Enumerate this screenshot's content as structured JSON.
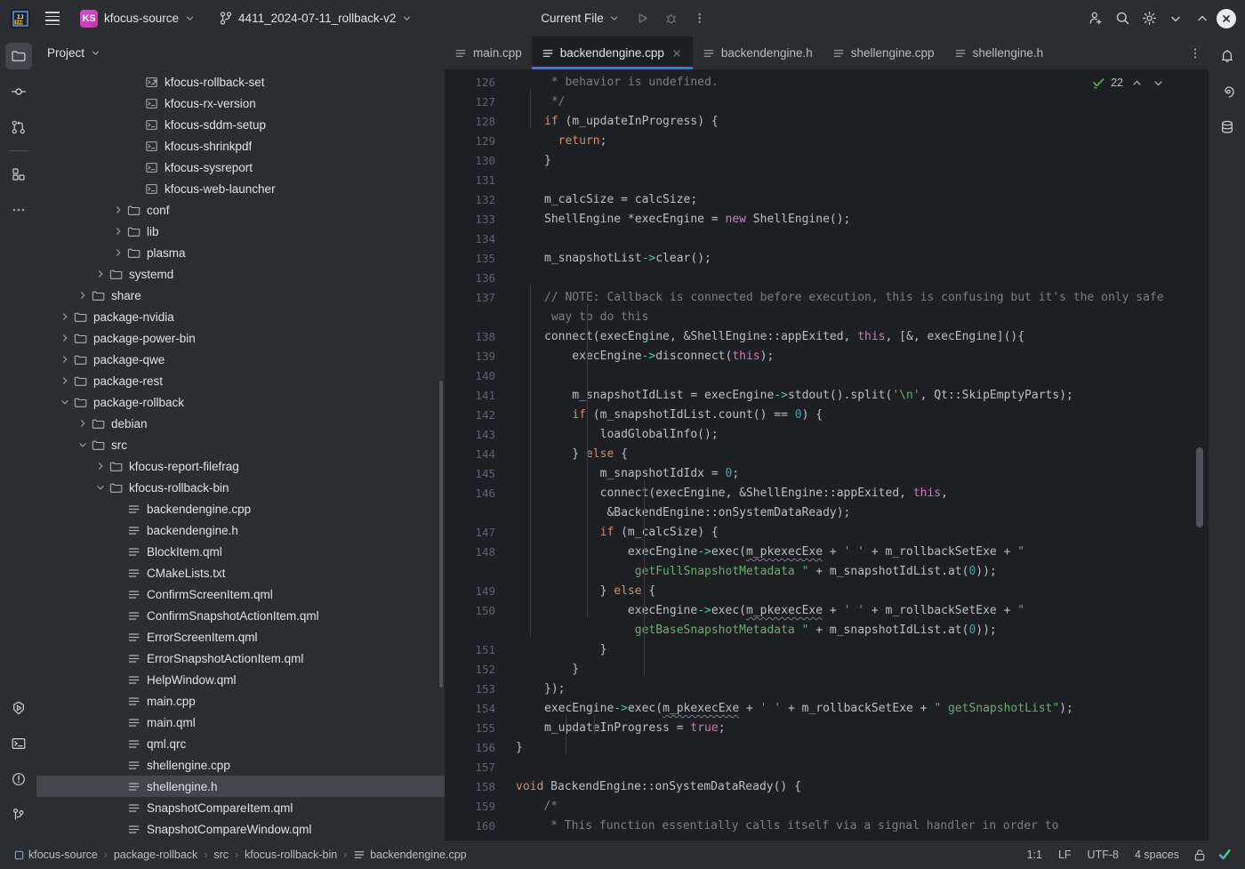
{
  "titlebar": {
    "menu_icon": "hamburger-icon",
    "logo": "intellij-idea-logo",
    "project_badge": "KS",
    "project_name": "kfocus-source",
    "branch_icon": "git-branch-icon",
    "branch_name": "4411_2024-07-11_rollback-v2",
    "run_config": "Current File",
    "run_icon": "run-icon",
    "debug_icon": "debug-icon",
    "more_icon": "more-vertical-icon",
    "share_icon": "add-user-icon",
    "search_icon": "search-icon",
    "settings_icon": "gear-icon",
    "minimize_icon": "chevron-down-icon",
    "maximize_icon": "chevron-up-icon",
    "close_icon": "close-icon"
  },
  "left_rail": {
    "items": [
      {
        "name": "project-tool-button",
        "icon": "folder-icon",
        "active": true
      },
      {
        "name": "commit-tool-button",
        "icon": "commit-icon",
        "active": false
      },
      {
        "name": "pull-requests-tool-button",
        "icon": "pull-request-icon",
        "active": false
      },
      {
        "name": "structure-tool-button",
        "icon": "structure-icon",
        "active": false
      },
      {
        "name": "more-tool-windows-button",
        "icon": "more-horizontal-icon",
        "active": false
      }
    ],
    "bottom_items": [
      {
        "name": "run-tool-button",
        "icon": "run-hexagon-icon"
      },
      {
        "name": "terminal-tool-button",
        "icon": "terminal-icon"
      },
      {
        "name": "problems-tool-button",
        "icon": "warning-circle-icon"
      },
      {
        "name": "git-tool-button",
        "icon": "git-branch-icon"
      }
    ]
  },
  "right_rail": {
    "items": [
      {
        "name": "notifications-button",
        "icon": "bell-icon"
      },
      {
        "name": "ai-assistant-button",
        "icon": "spiral-icon"
      },
      {
        "name": "database-button",
        "icon": "database-icon"
      }
    ]
  },
  "project_panel": {
    "title": "Project",
    "chevron_icon": "chevron-down-icon",
    "tree": [
      {
        "label": "kfocus-rollback-set",
        "depth": 5,
        "type": "script-link",
        "arrow": "none"
      },
      {
        "label": "kfocus-rx-version",
        "depth": 5,
        "type": "script",
        "arrow": "none"
      },
      {
        "label": "kfocus-sddm-setup",
        "depth": 5,
        "type": "script",
        "arrow": "none"
      },
      {
        "label": "kfocus-shrinkpdf",
        "depth": 5,
        "type": "script",
        "arrow": "none"
      },
      {
        "label": "kfocus-sysreport",
        "depth": 5,
        "type": "script",
        "arrow": "none"
      },
      {
        "label": "kfocus-web-launcher",
        "depth": 5,
        "type": "script",
        "arrow": "none"
      },
      {
        "label": "conf",
        "depth": 4,
        "type": "folder",
        "arrow": "collapsed"
      },
      {
        "label": "lib",
        "depth": 4,
        "type": "folder",
        "arrow": "collapsed"
      },
      {
        "label": "plasma",
        "depth": 4,
        "type": "folder",
        "arrow": "collapsed"
      },
      {
        "label": "systemd",
        "depth": 3,
        "type": "folder",
        "arrow": "collapsed"
      },
      {
        "label": "share",
        "depth": 2,
        "type": "folder",
        "arrow": "collapsed"
      },
      {
        "label": "package-nvidia",
        "depth": 1,
        "type": "folder",
        "arrow": "collapsed"
      },
      {
        "label": "package-power-bin",
        "depth": 1,
        "type": "folder",
        "arrow": "collapsed"
      },
      {
        "label": "package-qwe",
        "depth": 1,
        "type": "folder",
        "arrow": "collapsed"
      },
      {
        "label": "package-rest",
        "depth": 1,
        "type": "folder",
        "arrow": "collapsed"
      },
      {
        "label": "package-rollback",
        "depth": 1,
        "type": "folder",
        "arrow": "expanded"
      },
      {
        "label": "debian",
        "depth": 2,
        "type": "folder",
        "arrow": "collapsed"
      },
      {
        "label": "src",
        "depth": 2,
        "type": "folder",
        "arrow": "expanded"
      },
      {
        "label": "kfocus-report-filefrag",
        "depth": 3,
        "type": "folder",
        "arrow": "collapsed"
      },
      {
        "label": "kfocus-rollback-bin",
        "depth": 3,
        "type": "folder",
        "arrow": "expanded"
      },
      {
        "label": "backendengine.cpp",
        "depth": 4,
        "type": "file",
        "arrow": "none"
      },
      {
        "label": "backendengine.h",
        "depth": 4,
        "type": "file",
        "arrow": "none"
      },
      {
        "label": "BlockItem.qml",
        "depth": 4,
        "type": "file",
        "arrow": "none"
      },
      {
        "label": "CMakeLists.txt",
        "depth": 4,
        "type": "file",
        "arrow": "none"
      },
      {
        "label": "ConfirmScreenItem.qml",
        "depth": 4,
        "type": "file",
        "arrow": "none"
      },
      {
        "label": "ConfirmSnapshotActionItem.qml",
        "depth": 4,
        "type": "file",
        "arrow": "none"
      },
      {
        "label": "ErrorScreenItem.qml",
        "depth": 4,
        "type": "file",
        "arrow": "none"
      },
      {
        "label": "ErrorSnapshotActionItem.qml",
        "depth": 4,
        "type": "file",
        "arrow": "none"
      },
      {
        "label": "HelpWindow.qml",
        "depth": 4,
        "type": "file",
        "arrow": "none"
      },
      {
        "label": "main.cpp",
        "depth": 4,
        "type": "file",
        "arrow": "none"
      },
      {
        "label": "main.qml",
        "depth": 4,
        "type": "file",
        "arrow": "none"
      },
      {
        "label": "qml.qrc",
        "depth": 4,
        "type": "file",
        "arrow": "none"
      },
      {
        "label": "shellengine.cpp",
        "depth": 4,
        "type": "file",
        "arrow": "none"
      },
      {
        "label": "shellengine.h",
        "depth": 4,
        "type": "file",
        "arrow": "none",
        "selected": true
      },
      {
        "label": "SnapshotCompareItem.qml",
        "depth": 4,
        "type": "file",
        "arrow": "none"
      },
      {
        "label": "SnapshotCompareWindow.qml",
        "depth": 4,
        "type": "file",
        "arrow": "none"
      }
    ]
  },
  "editor": {
    "tabs": [
      {
        "label": "main.cpp",
        "active": false,
        "closable": false
      },
      {
        "label": "backendengine.cpp",
        "active": true,
        "closable": true
      },
      {
        "label": "backendengine.h",
        "active": false,
        "closable": false
      },
      {
        "label": "shellengine.cpp",
        "active": false,
        "closable": false
      },
      {
        "label": "shellengine.h",
        "active": false,
        "closable": false
      }
    ],
    "tab_options_icon": "more-vertical-icon",
    "inspection": {
      "status_icon": "inspection-ok-icon",
      "count": "22",
      "prev_icon": "chevron-up-icon",
      "next_icon": "chevron-down-icon"
    },
    "first_line_number": 126,
    "lines": [
      {
        "n": "126",
        "wrapped": false
      },
      {
        "n": "127",
        "wrapped": false
      },
      {
        "n": "128",
        "wrapped": false
      },
      {
        "n": "129",
        "wrapped": false
      },
      {
        "n": "130",
        "wrapped": false
      },
      {
        "n": "131",
        "wrapped": false
      },
      {
        "n": "132",
        "wrapped": false
      },
      {
        "n": "133",
        "wrapped": false
      },
      {
        "n": "134",
        "wrapped": false
      },
      {
        "n": "135",
        "wrapped": false
      },
      {
        "n": "136",
        "wrapped": false
      },
      {
        "n": "137",
        "wrapped": true
      },
      {
        "n": "138",
        "wrapped": false
      },
      {
        "n": "139",
        "wrapped": false
      },
      {
        "n": "140",
        "wrapped": false
      },
      {
        "n": "141",
        "wrapped": false
      },
      {
        "n": "142",
        "wrapped": false
      },
      {
        "n": "143",
        "wrapped": false
      },
      {
        "n": "144",
        "wrapped": false
      },
      {
        "n": "145",
        "wrapped": false
      },
      {
        "n": "146",
        "wrapped": true
      },
      {
        "n": "147",
        "wrapped": false
      },
      {
        "n": "148",
        "wrapped": true
      },
      {
        "n": "149",
        "wrapped": false
      },
      {
        "n": "150",
        "wrapped": true
      },
      {
        "n": "151",
        "wrapped": false
      },
      {
        "n": "152",
        "wrapped": false
      },
      {
        "n": "153",
        "wrapped": false
      },
      {
        "n": "154",
        "wrapped": false
      },
      {
        "n": "155",
        "wrapped": false
      },
      {
        "n": "156",
        "wrapped": false
      },
      {
        "n": "157",
        "wrapped": false
      },
      {
        "n": "158",
        "wrapped": false
      },
      {
        "n": "159",
        "wrapped": false
      },
      {
        "n": "160",
        "wrapped": false
      }
    ],
    "source_text": [
      " * behavior is undefined.",
      " */",
      "if (m_updateInProgress) {",
      "  return;",
      "}",
      "",
      "m_calcSize = calcSize;",
      "ShellEngine *execEngine = new ShellEngine();",
      "",
      "m_snapshotList->clear();",
      "",
      "// NOTE: Callback is connected before execution, this is confusing but it's the only safe way to do this",
      "connect(execEngine, &ShellEngine::appExited, this, [&, execEngine](){",
      "    execEngine->disconnect(this);",
      "",
      "    m_snapshotIdList = execEngine->stdout().split('\\n', Qt::SkipEmptyParts);",
      "    if (m_snapshotIdList.count() == 0) {",
      "        loadGlobalInfo();",
      "    } else {",
      "        m_snapshotIdIdx = 0;",
      "        connect(execEngine, &ShellEngine::appExited, this, &BackendEngine::onSystemDataReady);",
      "        if (m_calcSize) {",
      "            execEngine->exec(m_pkexecExe + ' ' + m_rollbackSetExe + \" getFullSnapshotMetadata \" + m_snapshotIdList.at(0));",
      "        } else {",
      "            execEngine->exec(m_pkexecExe + ' ' + m_rollbackSetExe + \" getBaseSnapshotMetadata \" + m_snapshotIdList.at(0));",
      "        }",
      "    }",
      "});",
      "execEngine->exec(m_pkexecExe + ' ' + m_rollbackSetExe + \" getSnapshotList\");",
      "m_updateInProgress = true;",
      "}",
      "",
      "void BackendEngine::onSystemDataReady() {",
      "    /*",
      "     * This function essentially calls itself via a signal handler in order to"
    ]
  },
  "statusbar": {
    "breadcrumbs": [
      {
        "label": "kfocus-source",
        "icon": "project-icon"
      },
      {
        "label": "package-rollback",
        "icon": null
      },
      {
        "label": "src",
        "icon": null
      },
      {
        "label": "kfocus-rollback-bin",
        "icon": null
      },
      {
        "label": "backendengine.cpp",
        "icon": "file-icon"
      }
    ],
    "separator": "›",
    "caret_position": "1:1",
    "line_separator": "LF",
    "encoding": "UTF-8",
    "indent": "4 spaces",
    "lock_icon": "unlocked-icon",
    "validation_icon": "checkmark-icon"
  },
  "colors": {
    "accent": "#3574f0",
    "panel_bg": "#2b2d30",
    "editor_bg": "#1e1f22",
    "selection": "#43454a",
    "text": "#dfe1e5",
    "keyword": "#cf8e6d",
    "keyword2": "#c77dbb",
    "string": "#6aab73",
    "number": "#2aacb8",
    "comment": "#7a7e85",
    "function": "#56a8f5",
    "arrow_op": "#4ec9b0",
    "gutter": "#5c6370"
  }
}
